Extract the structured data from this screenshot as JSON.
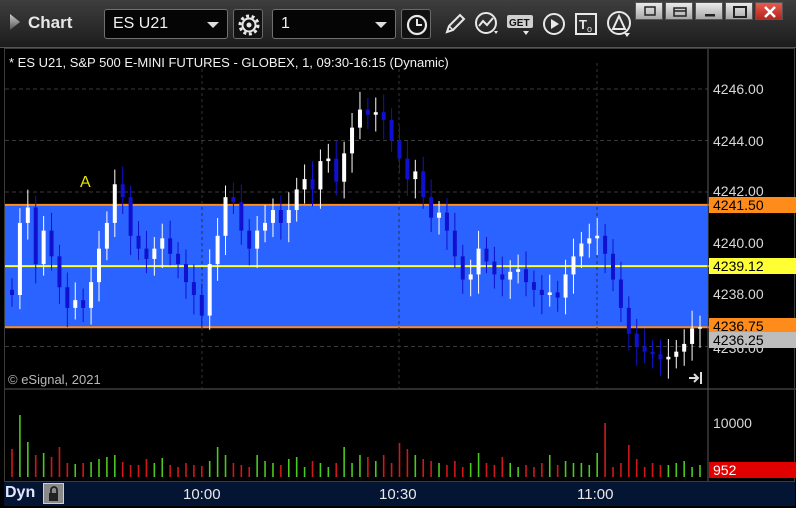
{
  "toolbar": {
    "title": "Chart",
    "symbol": "ES U21",
    "interval": "1",
    "icons": [
      "settings-gear-icon",
      "clock-icon",
      "pencil-draw-icon",
      "study-line-icon",
      "get-data-icon",
      "play-icon",
      "text-tool-icon",
      "alert-triangle-icon"
    ],
    "window_buttons": [
      "restore-icon",
      "unlink-icon",
      "minimize-icon",
      "close-icon"
    ]
  },
  "chart": {
    "header": "* ES U21, S&P 500 E-MINI FUTURES - GLOBEX, 1, 09:30-16:15 (Dynamic)",
    "copyright": "© eSignal, 2021",
    "annotation": "A",
    "price_ticks": [
      "4246.00",
      "4244.00",
      "4242.00",
      "4240.00",
      "4238.00",
      "4236.00"
    ],
    "labels": {
      "high": "4241.50",
      "mid": "4239.12",
      "low": "4236.75",
      "last": "4236.25"
    },
    "volume_tick": "10000",
    "volume_last": "952",
    "time_ticks": [
      "10:00",
      "10:30",
      "11:00"
    ],
    "mode_label": "Dyn",
    "colors": {
      "band": "#2a63ff",
      "band_lines": "#ff8c1a",
      "mid_line": "#ffff33",
      "up": "#ffffff",
      "down": "#1010d0",
      "vol_up": "#4ac91e",
      "vol_down": "#d01818"
    }
  },
  "chart_data": {
    "type": "candlestick",
    "ylim": [
      4235.0,
      4247.5
    ],
    "range_lines": [
      4241.5,
      4239.12,
      4236.75
    ],
    "closes": [
      4238,
      4240.8,
      4241.4,
      4239.2,
      4240.5,
      4239.5,
      4238.3,
      4237.5,
      4237.8,
      4237.5,
      4238.5,
      4239.8,
      4240.8,
      4242.3,
      4241.8,
      4240.3,
      4239.8,
      4239.4,
      4239.8,
      4240.2,
      4239.6,
      4239.2,
      4238.5,
      4238,
      4237.2,
      4239.2,
      4240.3,
      4241.8,
      4241.6,
      4240.5,
      4239.8,
      4240.5,
      4240.8,
      4241.3,
      4240.8,
      4241.3,
      4242.1,
      4242.5,
      4242.1,
      4243.2,
      4243.3,
      4242.4,
      4243.5,
      4244.5,
      4245.2,
      4245.0,
      4245.1,
      4244.8,
      4244.0,
      4243.3,
      4242.5,
      4242.8,
      4241.8,
      4241.0,
      4241.2,
      4240.5,
      4239.5,
      4238.6,
      4238.8,
      4239.8,
      4239.3,
      4238.8,
      4238.6,
      4238.9,
      4239.0,
      4238.5,
      4238.2,
      4238.0,
      4238.1,
      4237.9,
      4238.8,
      4239.5,
      4240.0,
      4240.2,
      4240.3,
      4239.6,
      4238.6,
      4237.5,
      4236.5,
      4236.0,
      4235.8,
      4235.7,
      4235.5,
      4235.6,
      4235.8,
      4236.1,
      4236.7,
      4236.75
    ],
    "volumes": [
      28,
      62,
      35,
      22,
      24,
      20,
      30,
      14,
      13,
      14,
      15,
      18,
      20,
      22,
      15,
      12,
      12,
      18,
      14,
      19,
      12,
      10,
      14,
      12,
      11,
      16,
      30,
      22,
      14,
      12,
      10,
      22,
      16,
      14,
      12,
      18,
      20,
      10,
      16,
      14,
      10,
      14,
      30,
      14,
      22,
      20,
      16,
      22,
      14,
      34,
      28,
      22,
      18,
      16,
      14,
      12,
      16,
      10,
      14,
      24,
      14,
      12,
      20,
      14,
      10,
      12,
      10,
      14,
      22,
      12,
      16,
      14,
      14,
      12,
      24,
      54,
      10,
      14,
      32,
      18,
      10,
      14,
      12,
      12,
      14,
      16,
      10,
      12
    ]
  }
}
